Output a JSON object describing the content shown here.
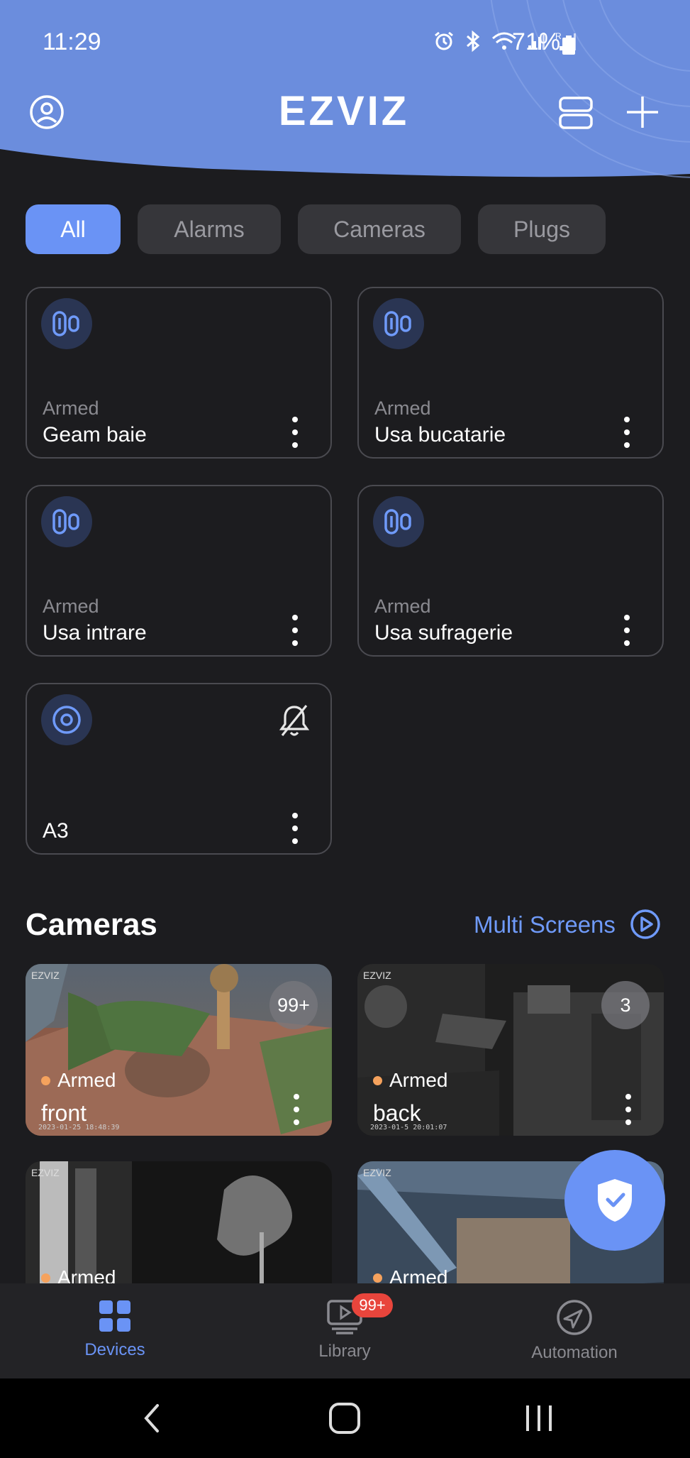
{
  "status_bar": {
    "time": "11:29",
    "battery": "71%"
  },
  "header": {
    "logo_text": "EZVIZ"
  },
  "filters": [
    {
      "label": "All",
      "active": true
    },
    {
      "label": "Alarms",
      "active": false
    },
    {
      "label": "Cameras",
      "active": false
    },
    {
      "label": "Plugs",
      "active": false
    }
  ],
  "devices": [
    {
      "state": "Armed",
      "name": "Geam baie",
      "icon": "door-sensor-icon"
    },
    {
      "state": "Armed",
      "name": "Usa bucatarie",
      "icon": "door-sensor-icon"
    },
    {
      "state": "Armed",
      "name": "Usa intrare",
      "icon": "door-sensor-icon"
    },
    {
      "state": "Armed",
      "name": "Usa sufragerie",
      "icon": "door-sensor-icon"
    },
    {
      "state": "",
      "name": "A3",
      "icon": "hub-icon",
      "muted": true
    }
  ],
  "cameras_section": {
    "title": "Cameras",
    "multi_screens_label": "Multi Screens",
    "items": [
      {
        "name": "front",
        "state": "Armed",
        "badge": "99+",
        "brand": "EZVIZ",
        "timestamp": "2023-01-25 18:48:39"
      },
      {
        "name": "back",
        "state": "Armed",
        "badge": "3",
        "brand": "EZVIZ",
        "timestamp": "2023-01-5 20:01:07"
      },
      {
        "name": "",
        "state": "Armed",
        "badge": "",
        "brand": "EZVIZ",
        "timestamp": ""
      },
      {
        "name": "",
        "state": "Armed",
        "badge": "",
        "brand": "EZVIZ",
        "timestamp": ""
      }
    ]
  },
  "bottom_nav": [
    {
      "label": "Devices",
      "active": true,
      "icon": "grid-icon"
    },
    {
      "label": "Library",
      "active": false,
      "icon": "library-icon",
      "badge": "99+"
    },
    {
      "label": "Automation",
      "active": false,
      "icon": "navigation-icon"
    }
  ],
  "colors": {
    "accent": "#6a93f5",
    "header_bg": "#6b8ddd",
    "background": "#1c1c1f",
    "armed_dot": "#f5a25d",
    "badge_red": "#e8453c"
  }
}
